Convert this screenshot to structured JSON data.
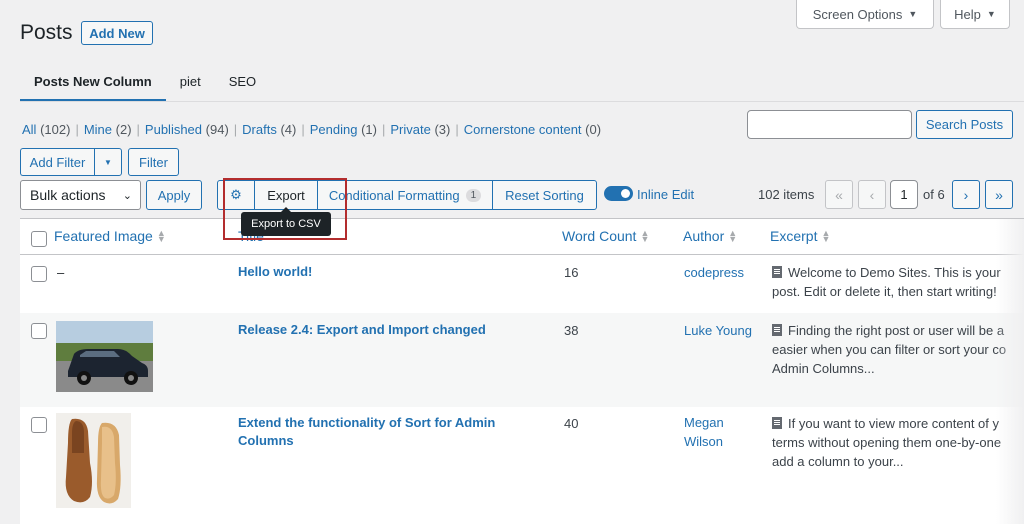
{
  "header": {
    "title": "Posts",
    "add_new": "Add New",
    "screen_options": "Screen Options",
    "help": "Help"
  },
  "tabs": [
    {
      "label": "Posts New Column",
      "active": true
    },
    {
      "label": "piet"
    },
    {
      "label": "SEO"
    }
  ],
  "views": [
    {
      "label": "All",
      "count": "(102)"
    },
    {
      "label": "Mine",
      "count": "(2)"
    },
    {
      "label": "Published",
      "count": "(94)"
    },
    {
      "label": "Drafts",
      "count": "(4)"
    },
    {
      "label": "Pending",
      "count": "(1)"
    },
    {
      "label": "Private",
      "count": "(3)"
    },
    {
      "label": "Cornerstone content",
      "count": "(0)"
    }
  ],
  "search": {
    "button": "Search Posts",
    "placeholder": ""
  },
  "filters": {
    "add_filter": "Add Filter",
    "filter": "Filter"
  },
  "actions": {
    "bulk_actions": "Bulk actions",
    "apply": "Apply",
    "export": "Export",
    "conditional_formatting": "Conditional Formatting",
    "cf_count": "1",
    "reset_sorting": "Reset Sorting",
    "inline_edit": "Inline Edit",
    "tooltip": "Export to CSV"
  },
  "pagination": {
    "items": "102 items",
    "current": "1",
    "of": "of 6",
    "first": "«",
    "prev": "‹",
    "next": "›",
    "last": "»"
  },
  "table": {
    "headers": {
      "featured_image": "Featured Image",
      "title": "Title",
      "word_count": "Word Count",
      "author": "Author",
      "excerpt": "Excerpt"
    },
    "rows": [
      {
        "image": "–",
        "title": "Hello world!",
        "word_count": "16",
        "author": "codepress",
        "excerpt": [
          "Welcome to Demo Sites. This is your",
          "post. Edit or delete it, then start writing!"
        ]
      },
      {
        "title": "Release 2.4: Export and Import changed",
        "word_count": "38",
        "author": "Luke Young",
        "excerpt": [
          "Finding the right post or user will be a",
          "easier when you can filter or sort your co",
          "Admin Columns..."
        ]
      },
      {
        "title_lines": [
          "Extend the functionality of Sort for Admin",
          "Columns"
        ],
        "word_count": "40",
        "author_lines": [
          "Megan",
          "Wilson"
        ],
        "excerpt": [
          "If you want to view more content of y",
          "terms without opening them one-by-one",
          "add a column to your..."
        ]
      }
    ]
  },
  "colors": {
    "accent": "#2271b1",
    "highlight": "#b32d2e",
    "background": "#f0f0f1"
  }
}
